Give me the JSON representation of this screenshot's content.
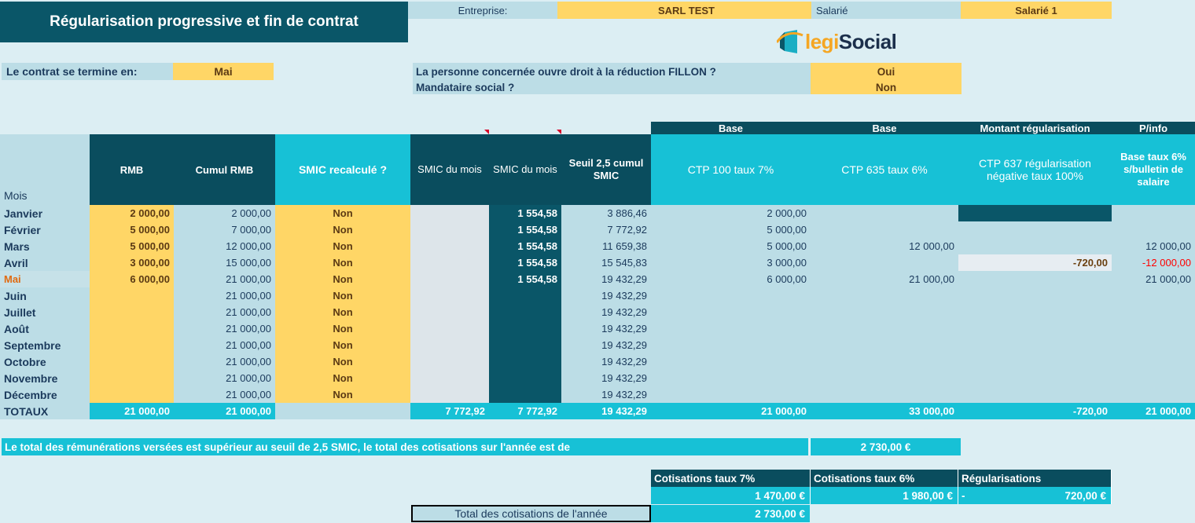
{
  "header": {
    "title": "Régularisation progressive et fin de contrat",
    "entreprise_label": "Entreprise:",
    "entreprise_value": "SARL TEST",
    "salarie_label": "Salarié",
    "salarie_value": "Salarié 1",
    "logo_legi": "legi",
    "logo_social": "Social"
  },
  "contract": {
    "end_label": "Le contrat se termine en:",
    "end_value": "Mai"
  },
  "questions": {
    "q1": "La personne concernée ouvre droit à la réduction FILLON ?",
    "q2": "Mandataire social ?",
    "a1": "Oui",
    "a2": "Non"
  },
  "grid": {
    "group_headers": {
      "base1": "Base",
      "base2": "Base",
      "montant": "Montant régularisation",
      "pinfo": "P/info"
    },
    "columns": {
      "mois": "Mois",
      "rmb": "RMB",
      "cumul_rmb": "Cumul RMB",
      "smic_recalcule": "SMIC recalculé ?",
      "smic_mois_1": "SMIC du mois",
      "smic_mois_2": "SMIC du mois",
      "seuil": "Seuil 2,5 cumul SMIC",
      "ctp100": "CTP 100 taux 7%",
      "ctp635": "CTP 635 taux 6%",
      "ctp637": "CTP 637 régularisation négative taux 100%",
      "base6": "Base taux 6% s/bulletin de salaire"
    },
    "rows": [
      {
        "mois": "Janvier",
        "rmb": "2 000,00",
        "cumul": "2 000,00",
        "recalc": "Non",
        "smic1": "",
        "smic2": "1 554,58",
        "seuil": "3 886,46",
        "ctp100": "2 000,00",
        "ctp635": "",
        "ctp637": "",
        "base6": ""
      },
      {
        "mois": "Février",
        "rmb": "5 000,00",
        "cumul": "7 000,00",
        "recalc": "Non",
        "smic1": "",
        "smic2": "1 554,58",
        "seuil": "7 772,92",
        "ctp100": "5 000,00",
        "ctp635": "",
        "ctp637": "",
        "base6": ""
      },
      {
        "mois": "Mars",
        "rmb": "5 000,00",
        "cumul": "12 000,00",
        "recalc": "Non",
        "smic1": "",
        "smic2": "1 554,58",
        "seuil": "11 659,38",
        "ctp100": "5 000,00",
        "ctp635": "12 000,00",
        "ctp637": "",
        "base6": "12 000,00"
      },
      {
        "mois": "Avril",
        "rmb": "3 000,00",
        "cumul": "15 000,00",
        "recalc": "Non",
        "smic1": "",
        "smic2": "1 554,58",
        "seuil": "15 545,83",
        "ctp100": "3 000,00",
        "ctp635": "",
        "ctp637": "-720,00",
        "base6": "-12 000,00"
      },
      {
        "mois": "Mai",
        "rmb": "6 000,00",
        "cumul": "21 000,00",
        "recalc": "Non",
        "smic1": "",
        "smic2": "1 554,58",
        "seuil": "19 432,29",
        "ctp100": "6 000,00",
        "ctp635": "21 000,00",
        "ctp637": "",
        "base6": "21 000,00"
      },
      {
        "mois": "Juin",
        "rmb": "",
        "cumul": "21 000,00",
        "recalc": "Non",
        "smic1": "",
        "smic2": "",
        "seuil": "19 432,29",
        "ctp100": "",
        "ctp635": "",
        "ctp637": "",
        "base6": ""
      },
      {
        "mois": "Juillet",
        "rmb": "",
        "cumul": "21 000,00",
        "recalc": "Non",
        "smic1": "",
        "smic2": "",
        "seuil": "19 432,29",
        "ctp100": "",
        "ctp635": "",
        "ctp637": "",
        "base6": ""
      },
      {
        "mois": "Août",
        "rmb": "",
        "cumul": "21 000,00",
        "recalc": "Non",
        "smic1": "",
        "smic2": "",
        "seuil": "19 432,29",
        "ctp100": "",
        "ctp635": "",
        "ctp637": "",
        "base6": ""
      },
      {
        "mois": "Septembre",
        "rmb": "",
        "cumul": "21 000,00",
        "recalc": "Non",
        "smic1": "",
        "smic2": "",
        "seuil": "19 432,29",
        "ctp100": "",
        "ctp635": "",
        "ctp637": "",
        "base6": ""
      },
      {
        "mois": "Octobre",
        "rmb": "",
        "cumul": "21 000,00",
        "recalc": "Non",
        "smic1": "",
        "smic2": "",
        "seuil": "19 432,29",
        "ctp100": "",
        "ctp635": "",
        "ctp637": "",
        "base6": ""
      },
      {
        "mois": "Novembre",
        "rmb": "",
        "cumul": "21 000,00",
        "recalc": "Non",
        "smic1": "",
        "smic2": "",
        "seuil": "19 432,29",
        "ctp100": "",
        "ctp635": "",
        "ctp637": "",
        "base6": ""
      },
      {
        "mois": "Décembre",
        "rmb": "",
        "cumul": "21 000,00",
        "recalc": "Non",
        "smic1": "",
        "smic2": "",
        "seuil": "19 432,29",
        "ctp100": "",
        "ctp635": "",
        "ctp637": "",
        "base6": ""
      }
    ],
    "totals": {
      "label": "TOTAUX",
      "rmb": "21 000,00",
      "cumul": "21 000,00",
      "recalc": "",
      "smic1": "7 772,92",
      "smic2": "7 772,92",
      "seuil": "19 432,29",
      "ctp100": "21 000,00",
      "ctp635": "33 000,00",
      "ctp637": "-720,00",
      "base6": "21 000,00"
    }
  },
  "summary": {
    "message": "Le total des rémunérations versées est supérieur au seuil de 2,5 SMIC, le total des cotisations sur l'année est de",
    "message_value": "2 730,00 €"
  },
  "footer": {
    "cot7_label": "Cotisations taux 7%",
    "cot6_label": "Cotisations taux 6%",
    "reg_label": "Régularisations",
    "cot7_value": "1 470,00 €",
    "cot6_value": "1 980,00 €",
    "reg_sign": "-",
    "reg_value": "720,00 €",
    "total_label": "Total des cotisations de l'année",
    "total_value": "2 730,00 €"
  }
}
